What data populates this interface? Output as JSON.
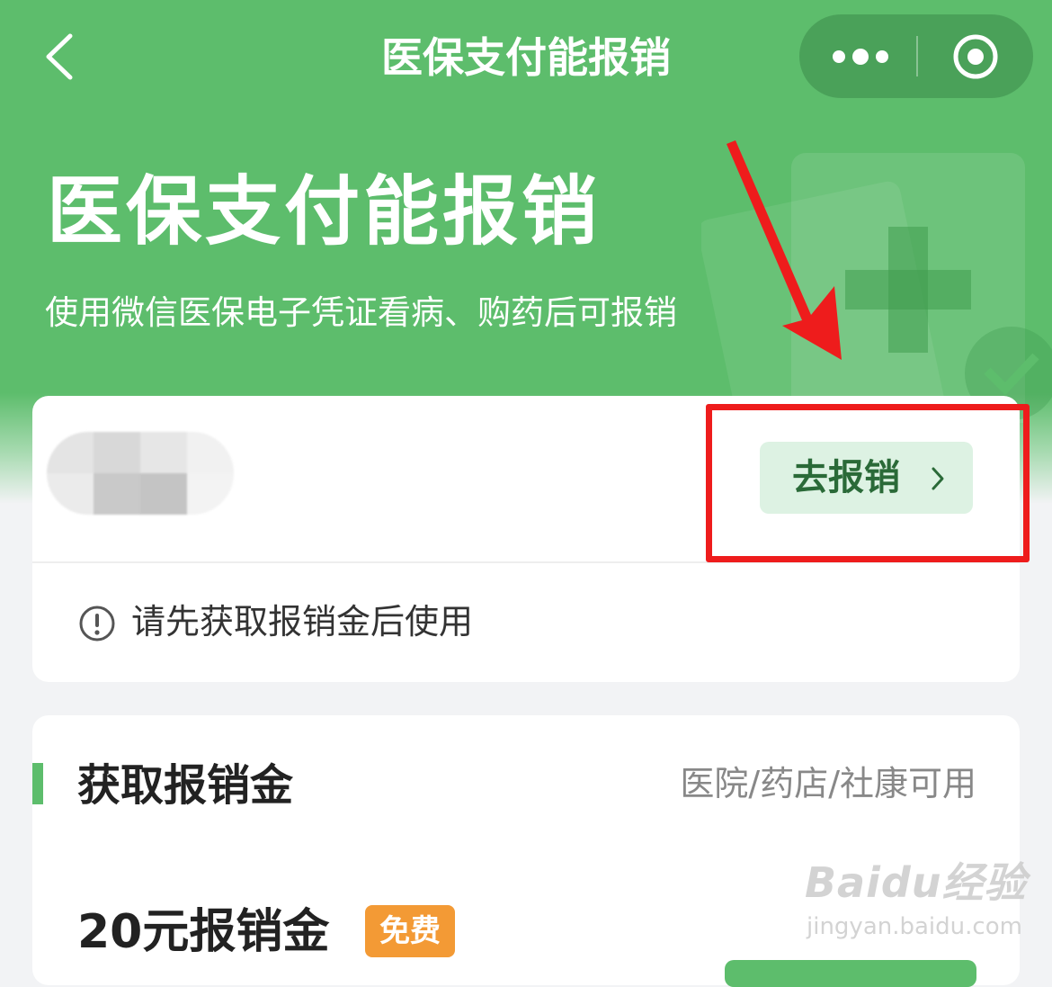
{
  "nav": {
    "title": "医保支付能报销",
    "back_icon": "chevron-left-icon",
    "more_icon": "more-dots-icon",
    "close_icon": "target-close-icon"
  },
  "hero": {
    "title": "医保支付能报销",
    "subtitle": "使用微信医保电子凭证看病、购药后可报销"
  },
  "account_card": {
    "reimburse_button": "去报销",
    "notice": "请先获取报销金后使用",
    "notice_icon": "info-circle-icon"
  },
  "fund_section": {
    "title": "获取报销金",
    "note": "医院/药店/社康可用",
    "amount_title": "20元报销金",
    "badge": "免费"
  },
  "watermark": {
    "brand_left": "Bai",
    "brand_mid": "du",
    "brand_right": "经验",
    "site": "jingyan.baidu.com"
  },
  "colors": {
    "brand_green": "#5dbd6c",
    "button_bg": "#ddf2e3",
    "button_text": "#2a6a38",
    "badge_orange": "#f39a35",
    "highlight_red": "#ee1c1c"
  }
}
